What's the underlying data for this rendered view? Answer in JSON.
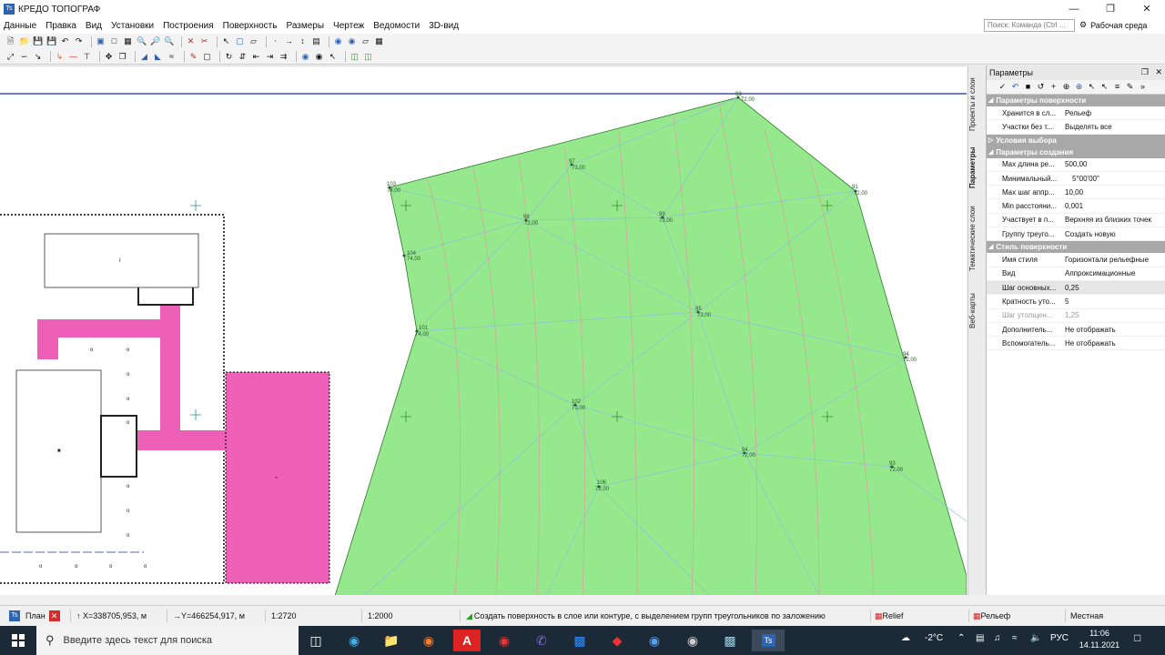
{
  "window": {
    "title": "КРЕДО ТОПОГРАФ",
    "icon_label": "Ts"
  },
  "menu": [
    "Данные",
    "Правка",
    "Вид",
    "Установки",
    "Построения",
    "Поверхность",
    "Размеры",
    "Чертеж",
    "Ведомости",
    "3D-вид"
  ],
  "search": {
    "placeholder": "Поиск: Команда (Ctrl ..."
  },
  "workspace_label": "Рабочая среда",
  "side_tabs": [
    "Проекты и слои",
    "Параметры",
    "Тематические слои",
    "Веб-карты"
  ],
  "params": {
    "title": "Параметры",
    "groups": [
      {
        "title": "Параметры поверхности",
        "rows": [
          {
            "k": "Хранится в сл...",
            "v": "Рельеф"
          },
          {
            "k": "Участки без т...",
            "v": "Выделять все"
          }
        ]
      },
      {
        "title": "Условия выбора",
        "rows": []
      },
      {
        "title": "Параметры создания",
        "rows": [
          {
            "k": "Max длина ре...",
            "v": "500,00"
          },
          {
            "k": "Минимальный...",
            "v": "5°00'00\""
          },
          {
            "k": "Max шаг аппр...",
            "v": "10,00"
          },
          {
            "k": "Min расстояни...",
            "v": "0,001"
          },
          {
            "k": "Участвует в п...",
            "v": "Верхняя из близких точек"
          },
          {
            "k": "Группу треуго...",
            "v": "Создать новую"
          }
        ]
      },
      {
        "title": "Стиль поверхности",
        "rows": [
          {
            "k": "Имя стиля",
            "v": "Горизонтали рельефные"
          },
          {
            "k": "Вид",
            "v": "Аппроксимационные"
          },
          {
            "k": "Шаг основных...",
            "v": "0,25"
          },
          {
            "k": "Кратность уто...",
            "v": "5"
          },
          {
            "k": "Шаг утолщен...",
            "v": "1,25"
          },
          {
            "k": "Дополнитель...",
            "v": "Не отображать"
          },
          {
            "k": "Вспомогатель...",
            "v": "Не отображать"
          }
        ]
      }
    ]
  },
  "points": [
    {
      "n": "93",
      "h": "72,00"
    },
    {
      "n": "97",
      "h": "73,00"
    },
    {
      "n": "91",
      "h": "72,00"
    },
    {
      "n": "103",
      "h": "74,00"
    },
    {
      "n": "98",
      "h": "72,00"
    },
    {
      "n": "99",
      "h": "73,00"
    },
    {
      "n": "104",
      "h": "74,00"
    },
    {
      "n": "95",
      "h": "73,00"
    },
    {
      "n": "101",
      "h": "74,00"
    },
    {
      "n": "94",
      "h": "72,00"
    },
    {
      "n": "102",
      "h": "73,00"
    },
    {
      "n": "94",
      "h": "72,00"
    },
    {
      "n": "93",
      "h": "72,00"
    },
    {
      "n": "106",
      "h": "72,00"
    }
  ],
  "status": {
    "tab": "План",
    "x": "X=338705,953, м",
    "y": "Y=466254,917, м",
    "scale1": "1:2720",
    "scale2": "1:2000",
    "hint": "Создать поверхность в слое или контуре, с выделением групп треугольников по заложению",
    "layer1": "Relief",
    "layer2": "Рельеф",
    "cs": "Местная"
  },
  "taskbar": {
    "search_placeholder": "Введите здесь текст для поиска",
    "weather": "-2°C",
    "lang": "РУС",
    "time": "11:06",
    "date": "14.11.2021"
  }
}
